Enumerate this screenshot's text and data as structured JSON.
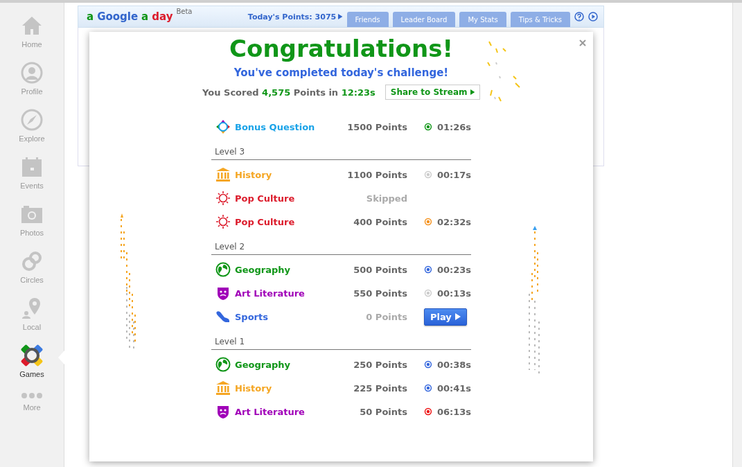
{
  "sidebar": {
    "items": [
      {
        "kind": "home",
        "label": "Home",
        "selected": false
      },
      {
        "kind": "profile",
        "label": "Profile",
        "selected": false
      },
      {
        "kind": "explore",
        "label": "Explore",
        "selected": false
      },
      {
        "kind": "events",
        "label": "Events",
        "selected": false
      },
      {
        "kind": "photos",
        "label": "Photos",
        "selected": false
      },
      {
        "kind": "circles",
        "label": "Circles",
        "selected": false
      },
      {
        "kind": "local",
        "label": "Local",
        "selected": false
      },
      {
        "kind": "games",
        "label": "Games",
        "selected": true
      },
      {
        "kind": "more",
        "label": "More",
        "selected": false
      }
    ]
  },
  "header": {
    "logo": [
      {
        "text": "a",
        "color": "#109618"
      },
      {
        "text": "Google",
        "color": "#3366cc"
      },
      {
        "text": "a",
        "color": "#109618"
      },
      {
        "text": "day",
        "color": "#dc1c2c"
      }
    ],
    "badge": "Beta",
    "points_link": "Today's Points: 3075",
    "tabs": [
      {
        "label": "Friends",
        "selected": false
      },
      {
        "label": "Leader Board",
        "selected": false
      },
      {
        "label": "My Stats",
        "selected": false
      },
      {
        "label": "Tips & Tricks",
        "selected": false
      }
    ]
  },
  "dialog": {
    "title": "Congratulations!",
    "subtitle": "You've completed today's challenge!",
    "score": {
      "prefix": "You Scored",
      "points": "4,575",
      "middle": "Points in",
      "time": "12:23s"
    },
    "share_button": "Share to Stream",
    "bonus": {
      "kind": "bonus",
      "name": "Bonus Question",
      "color": "#1aa3e8",
      "points": "1500 Points",
      "dimmed": false,
      "time": "01:26s",
      "timer": {
        "color": "#109618"
      }
    },
    "levels": [
      {
        "label": "Level 3",
        "rows": [
          {
            "kind": "history",
            "name": "History",
            "color": "#f5a623",
            "points": "1100 Points",
            "dimmed": false,
            "time": "00:17s",
            "timer": {
              "color": "#cccccc"
            }
          },
          {
            "kind": "pop",
            "name": "Pop Culture",
            "color": "#dc1c2c",
            "points": "Skipped",
            "dimmed": true
          },
          {
            "kind": "pop",
            "name": "Pop Culture",
            "color": "#dc1c2c",
            "points": "400 Points",
            "dimmed": false,
            "time": "02:32s",
            "timer": {
              "color": "#f5921e"
            }
          }
        ]
      },
      {
        "label": "Level 2",
        "rows": [
          {
            "kind": "geography",
            "name": "Geography",
            "color": "#109618",
            "points": "500 Points",
            "dimmed": false,
            "time": "00:23s",
            "timer": {
              "color": "#3366dd"
            }
          },
          {
            "kind": "art",
            "name": "Art Literature",
            "color": "#a000b8",
            "points": "550 Points",
            "dimmed": false,
            "time": "00:13s",
            "timer": {
              "color": "#cccccc"
            }
          },
          {
            "kind": "sports",
            "name": "Sports",
            "color": "#3366dd",
            "points": "0 Points",
            "dimmed": true,
            "button": "Play"
          }
        ]
      },
      {
        "label": "Level 1",
        "rows": [
          {
            "kind": "geography",
            "name": "Geography",
            "color": "#109618",
            "points": "250 Points",
            "dimmed": false,
            "time": "00:38s",
            "timer": {
              "color": "#3366dd"
            }
          },
          {
            "kind": "history",
            "name": "History",
            "color": "#f5a623",
            "points": "225 Points",
            "dimmed": false,
            "time": "00:41s",
            "timer": {
              "color": "#3366dd"
            }
          },
          {
            "kind": "art",
            "name": "Art Literature",
            "color": "#a000b8",
            "points": "50 Points",
            "dimmed": false,
            "time": "06:13s",
            "timer": {
              "color": "#ee1111"
            }
          }
        ]
      }
    ]
  }
}
